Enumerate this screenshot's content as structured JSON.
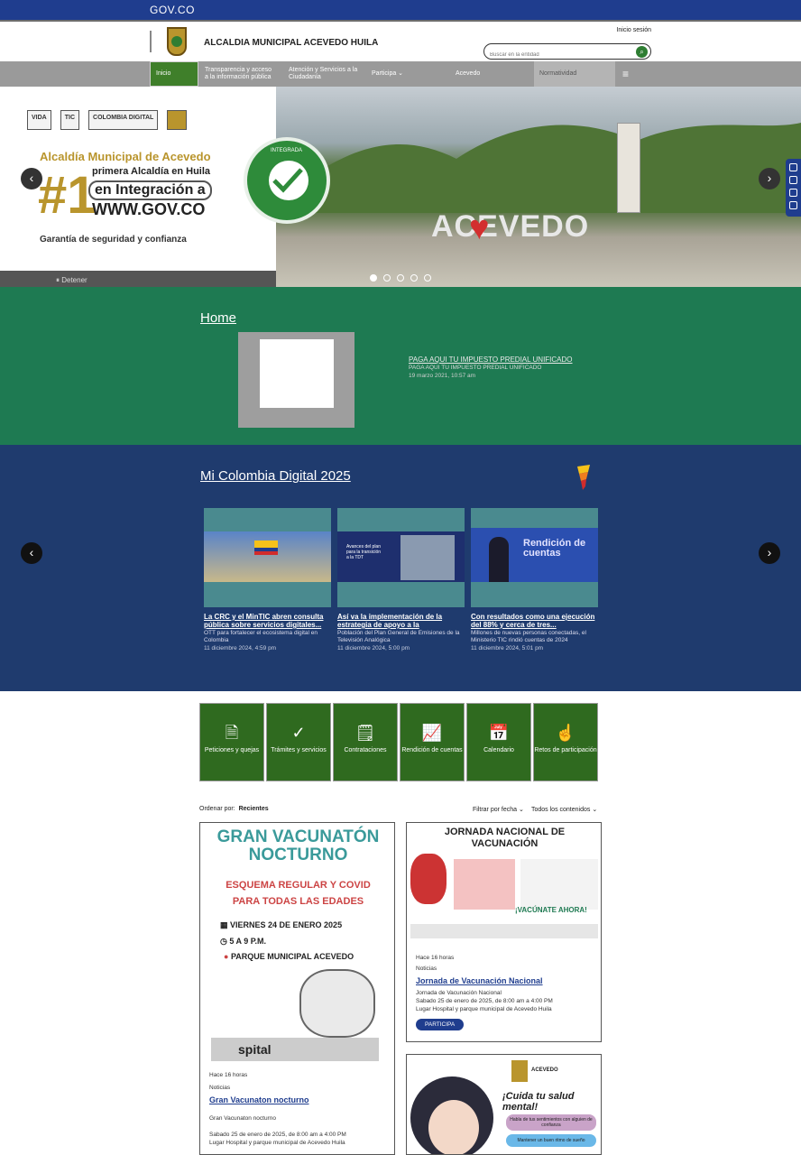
{
  "gov_bar": {
    "logo": "GOV.CO"
  },
  "header": {
    "site_title": "ALCALDIA MUNICIPAL ACEVEDO HUILA",
    "login_label": "Inicio sesión",
    "search_placeholder": "Buscar en la entidad"
  },
  "nav": {
    "items": [
      {
        "label": "Inicio"
      },
      {
        "label": "Transparencia y acceso a la información pública"
      },
      {
        "label": "Atención y Servicios a la Ciudadanía"
      },
      {
        "label": "Participa"
      },
      {
        "label": "Acevedo"
      },
      {
        "label": "Normatividad"
      }
    ]
  },
  "hero": {
    "logos": [
      "VIDA",
      "TIC",
      "COLOMBIA DIGITAL",
      ""
    ],
    "line1": "Alcaldía Municipal de Acevedo",
    "line2": "primera Alcaldía en Huila",
    "number": "#1",
    "line3": "en Integración a",
    "line4": "WWW.GOV.CO",
    "line5": "Garantía de seguridad y confianza",
    "seal_text": "INTEGRADA",
    "sign_text": "ACEVEDO",
    "stop_label": "Detener",
    "slide_count": 5,
    "active_slide": 1
  },
  "home_section": {
    "heading": "Home",
    "item_title": "PAGA AQUI TU IMPUESTO PREDIAL UNIFICADO",
    "item_subtitle": "PAGA AQUI TU IMPUESTO PREDIAL UNIFICADO",
    "item_date": "19 marzo 2021, 10:57 am"
  },
  "digital_section": {
    "heading": "Mi Colombia Digital 2025",
    "cards": [
      {
        "title": "La CRC y el MinTIC abren consulta pública sobre servicios digitales...",
        "subtitle": "OTT para fortalecer el ecosistema digital en Colombia",
        "date": "11 diciembre 2024, 4:59 pm",
        "img_text": ""
      },
      {
        "title": "Así va la implementación de la estrategia de apoyo a la",
        "subtitle": "Población del Plan General de Emisiones de la Televisión Analógica",
        "date": "11 diciembre 2024, 5:00 pm",
        "img_text": "Avances del plan para la transición a la TDT"
      },
      {
        "title": "Con resultados como una ejecución del 88% y cerca de tres...",
        "subtitle": "Millones de nuevas personas conectadas, el Ministerio TIC rindió cuentas de 2024",
        "date": "11 diciembre 2024, 5:01 pm",
        "img_text": "Rendición de cuentas"
      }
    ]
  },
  "tiles": [
    {
      "label": "Peticiones y quejas",
      "icon": "document-icon",
      "glyph": "🗎"
    },
    {
      "label": "Trámites y servicios",
      "icon": "check-icon",
      "glyph": "✓"
    },
    {
      "label": "Contrataciones",
      "icon": "contract-icon",
      "glyph": "🗒"
    },
    {
      "label": "Rendición de cuentas",
      "icon": "chart-icon",
      "glyph": "📈"
    },
    {
      "label": "Calendario",
      "icon": "calendar-icon",
      "glyph": "📅"
    },
    {
      "label": "Retos de participación",
      "icon": "hand-icon",
      "glyph": "☝"
    }
  ],
  "filter": {
    "order_label": "Ordenar por:",
    "order_value": "Recientes",
    "date_filter": "Filtrar por fecha",
    "content_filter": "Todos los contenidos"
  },
  "posts": [
    {
      "poster": {
        "title_a": "GRAN VACUNATÓN",
        "title_b": "NOCTURNO",
        "sub_a": "ESQUEMA REGULAR Y COVID",
        "sub_b": "PARA TODAS LAS EDADES",
        "date": "VIERNES 24 DE ENERO 2025",
        "time": "5 A 9 P.M.",
        "place": "PARQUE MUNICIPAL ACEVEDO",
        "hospital": "spital"
      },
      "age": "Hace 16 horas",
      "category": "Noticias",
      "title": "Gran Vacunaton nocturno",
      "line1": "Gran Vacunaton nocturno",
      "line2": "Sabado 25 de enero de 2025, de 8:00 am a 4:00 PM",
      "line3": "Lugar Hospital y parque municipal de Acevedo Huila"
    },
    {
      "poster": {
        "title_a": "JORNADA NACIONAL DE",
        "title_b": "VACUNACIÓN",
        "footer": "¡VACÚNATE AHORA!"
      },
      "age": "Hace 16 horas",
      "category": "Noticias",
      "title": "Jornada de Vacunación Nacional",
      "line1": "Jornada de Vacunación Nacional",
      "line2": "Sabado 25 de enero de 2025, de 8:00 am a 4:00 PM",
      "line3": "Lugar Hospital y parque municipal de Acevedo Huila",
      "button": "PARTICIPA"
    },
    {
      "poster": {
        "brand": "ACEVEDO",
        "slogan": "¡Cuida tu salud mental!",
        "bubble1": "Habla de tus sentimientos con alguien de confianza",
        "bubble2": "Mantener un buen ritmo de sueño"
      }
    }
  ],
  "colors": {
    "gov_blue": "#1f3d8e",
    "brand_green": "#2f6a1f",
    "home_green": "#1e7a52",
    "digital_blue": "#1f3b6e"
  }
}
